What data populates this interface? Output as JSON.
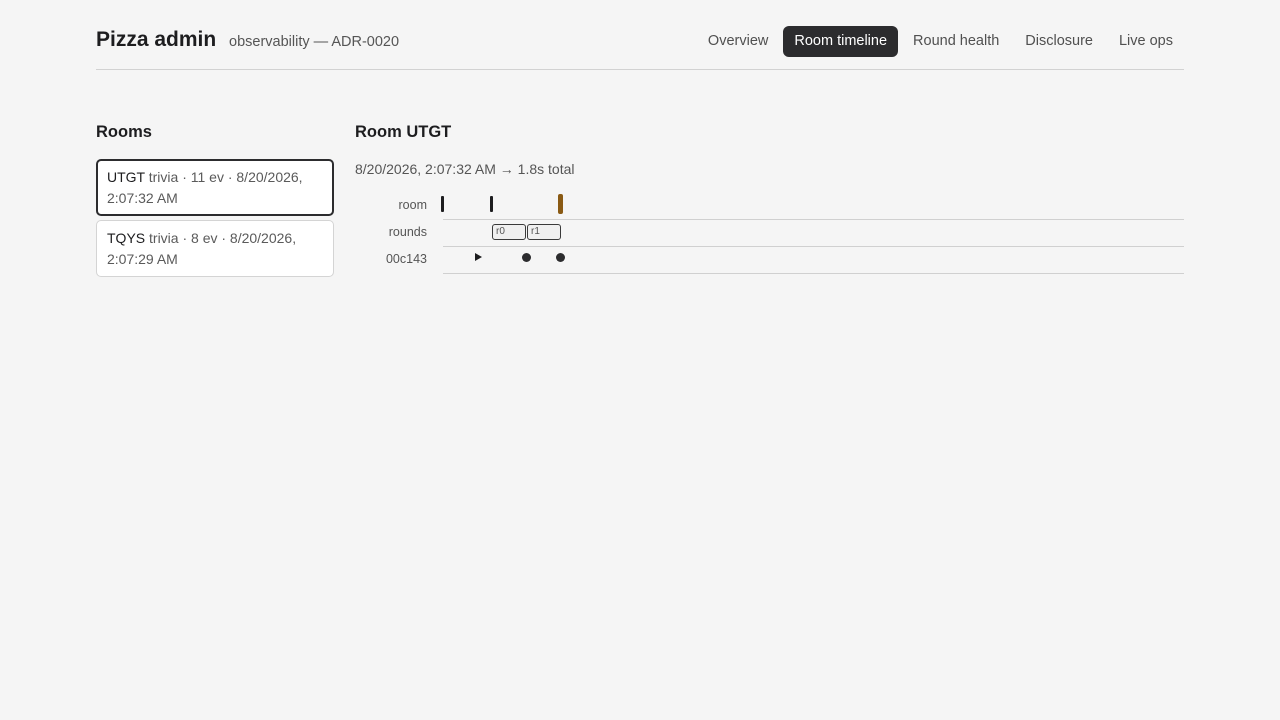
{
  "header": {
    "brand": "Pizza admin",
    "subtitle": "observability — ADR-0020",
    "nav": [
      {
        "label": "Overview",
        "active": false
      },
      {
        "label": "Room timeline",
        "active": true
      },
      {
        "label": "Round health",
        "active": false
      },
      {
        "label": "Disclosure",
        "active": false
      },
      {
        "label": "Live ops",
        "active": false
      }
    ]
  },
  "rooms": {
    "title": "Rooms",
    "items": [
      {
        "code": "UTGT",
        "meta": " trivia · 11 ev · 8/20/2026, 2:07:32 AM",
        "selected": true
      },
      {
        "code": "TQYS",
        "meta": " trivia · 8 ev · 8/20/2026, 2:07:29 AM",
        "selected": false
      }
    ]
  },
  "detail": {
    "title": "Room UTGT",
    "range": "8/20/2026, 2:07:32 AM → 1.8s total",
    "lanes": [
      {
        "label": "room"
      },
      {
        "label": "rounds",
        "rounds": [
          "r0",
          "r1"
        ]
      },
      {
        "label": "00c143"
      }
    ]
  },
  "colors": {
    "accent": "#2c2c2e",
    "warning_tick": "#8a5a14"
  }
}
